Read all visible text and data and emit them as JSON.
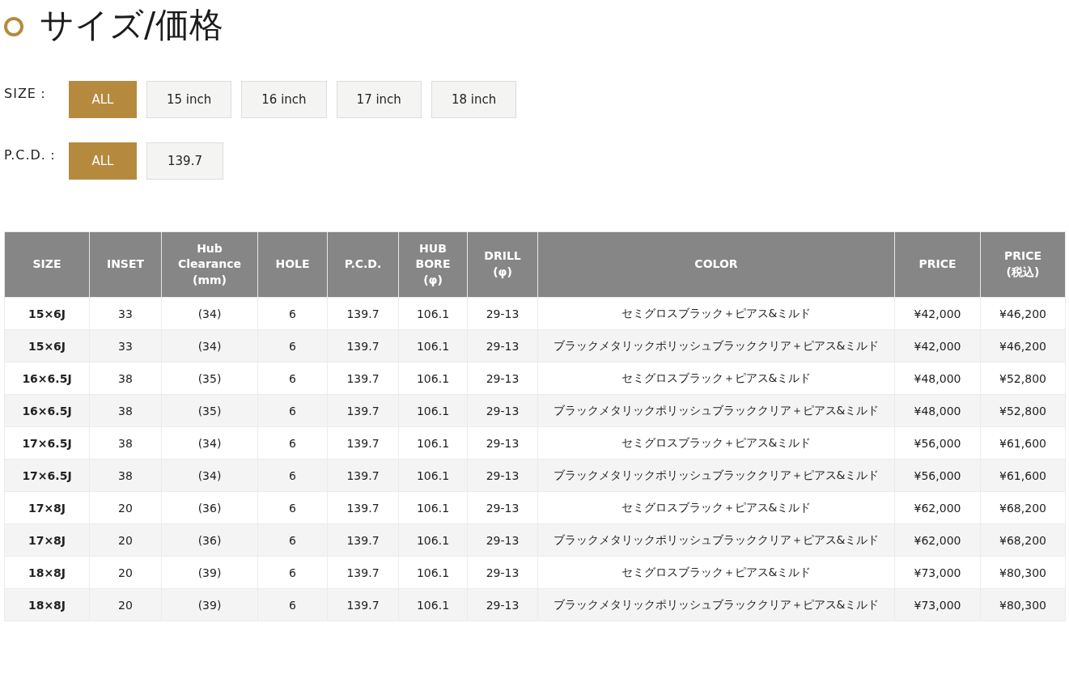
{
  "heading": "サイズ/価格",
  "filters": [
    {
      "label": "SIZE：",
      "options": [
        {
          "label": "ALL",
          "selected": true
        },
        {
          "label": "15 inch",
          "selected": false
        },
        {
          "label": "16 inch",
          "selected": false
        },
        {
          "label": "17 inch",
          "selected": false
        },
        {
          "label": "18 inch",
          "selected": false
        }
      ]
    },
    {
      "label": "P.C.D.：",
      "options": [
        {
          "label": "ALL",
          "selected": true
        },
        {
          "label": "139.7",
          "selected": false
        }
      ]
    }
  ],
  "table": {
    "columns": [
      "SIZE",
      "INSET",
      "Hub\nClearance\n(mm)",
      "HOLE",
      "P.C.D.",
      "HUB\nBORE\n(φ)",
      "DRILL\n(φ)",
      "COLOR",
      "PRICE",
      "PRICE\n(税込)"
    ],
    "rows": [
      [
        "15×6J",
        "33",
        "(34)",
        "6",
        "139.7",
        "106.1",
        "29-13",
        "セミグロスブラック＋ピアス&ミルド",
        "¥42,000",
        "¥46,200"
      ],
      [
        "15×6J",
        "33",
        "(34)",
        "6",
        "139.7",
        "106.1",
        "29-13",
        "ブラックメタリックポリッシュブラッククリア＋ピアス&ミルド",
        "¥42,000",
        "¥46,200"
      ],
      [
        "16×6.5J",
        "38",
        "(35)",
        "6",
        "139.7",
        "106.1",
        "29-13",
        "セミグロスブラック＋ピアス&ミルド",
        "¥48,000",
        "¥52,800"
      ],
      [
        "16×6.5J",
        "38",
        "(35)",
        "6",
        "139.7",
        "106.1",
        "29-13",
        "ブラックメタリックポリッシュブラッククリア＋ピアス&ミルド",
        "¥48,000",
        "¥52,800"
      ],
      [
        "17×6.5J",
        "38",
        "(34)",
        "6",
        "139.7",
        "106.1",
        "29-13",
        "セミグロスブラック＋ピアス&ミルド",
        "¥56,000",
        "¥61,600"
      ],
      [
        "17×6.5J",
        "38",
        "(34)",
        "6",
        "139.7",
        "106.1",
        "29-13",
        "ブラックメタリックポリッシュブラッククリア＋ピアス&ミルド",
        "¥56,000",
        "¥61,600"
      ],
      [
        "17×8J",
        "20",
        "(36)",
        "6",
        "139.7",
        "106.1",
        "29-13",
        "セミグロスブラック＋ピアス&ミルド",
        "¥62,000",
        "¥68,200"
      ],
      [
        "17×8J",
        "20",
        "(36)",
        "6",
        "139.7",
        "106.1",
        "29-13",
        "ブラックメタリックポリッシュブラッククリア＋ピアス&ミルド",
        "¥62,000",
        "¥68,200"
      ],
      [
        "18×8J",
        "20",
        "(39)",
        "6",
        "139.7",
        "106.1",
        "29-13",
        "セミグロスブラック＋ピアス&ミルド",
        "¥73,000",
        "¥80,300"
      ],
      [
        "18×8J",
        "20",
        "(39)",
        "6",
        "139.7",
        "106.1",
        "29-13",
        "ブラックメタリックポリッシュブラッククリア＋ピアス&ミルド",
        "¥73,000",
        "¥80,300"
      ]
    ]
  }
}
